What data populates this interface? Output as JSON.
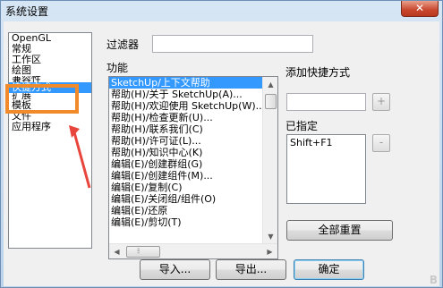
{
  "window": {
    "title": "系统设置",
    "close_label": "✕"
  },
  "left_list": {
    "items": [
      "OpenGL",
      "常规",
      "工作区",
      "绘图",
      "兼容性",
      "快捷方式",
      "扩展",
      "模板",
      "文件",
      "应用程序"
    ],
    "selected": "快捷方式"
  },
  "filter": {
    "label": "过滤器",
    "value": ""
  },
  "functions": {
    "label": "功能",
    "items": [
      "SketchUp/上下文帮助",
      "帮助(H)/关于 SketchUp(A)...",
      "帮助(H)/欢迎使用 SketchUp(W)...",
      "帮助(H)/检查更新(U)...",
      "帮助(H)/联系我们(C)",
      "帮助(H)/许可证(L)...",
      "帮助(H)/知识中心(K)",
      "编辑(E)/创建群组(G)",
      "编辑(E)/创建组件(M)...",
      "编辑(E)/复制(C)",
      "编辑(E)/关闭组/组件(O)",
      "编辑(E)/还原",
      "编辑(E)/剪切(T)"
    ]
  },
  "add_shortcut": {
    "label": "添加快捷方式",
    "value": "",
    "add_label": "+"
  },
  "assigned": {
    "label": "已指定",
    "items": [
      "Shift+F1"
    ],
    "remove_label": "-"
  },
  "buttons": {
    "reset_all": "全部重置",
    "import": "导入...",
    "export": "导出...",
    "ok": "确定"
  },
  "watermark": "B",
  "colors": {
    "highlight": "#f08a2a",
    "selection": "#3399ff",
    "arrow": "#e8453c"
  }
}
